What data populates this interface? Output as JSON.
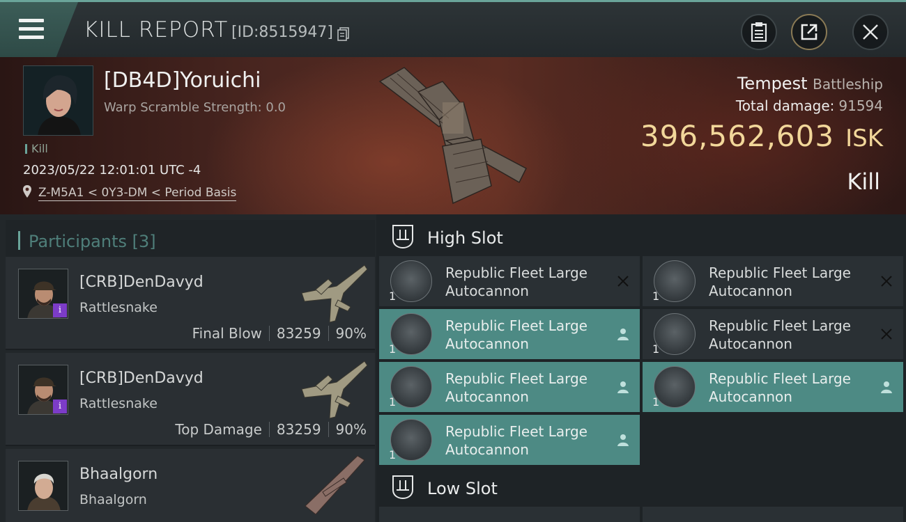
{
  "header": {
    "title": "KILL REPORT",
    "report_id": "[ID:8515947]"
  },
  "victim": {
    "name": "[DB4D]Yoruichi",
    "warp_scramble": "Warp Scramble Strength: 0.0",
    "kill_tag": "Kill",
    "datetime": "2023/05/22 12:01:01 UTC -4",
    "location": "Z-M5A1 < 0Y3-DM < Period Basis",
    "ship_name": "Tempest",
    "ship_class": "Battleship",
    "total_damage_label": "Total damage:",
    "total_damage": "91594",
    "isk_value": "396,562,603",
    "isk_unit": "ISK",
    "result": "Kill"
  },
  "participants": {
    "title": "Participants [3]",
    "items": [
      {
        "name": "[CRB]DenDavyd",
        "ship": "Rattlesnake",
        "role": "Final Blow",
        "damage": "83259",
        "percent": "90%",
        "badge": "i"
      },
      {
        "name": "[CRB]DenDavyd",
        "ship": "Rattlesnake",
        "role": "Top Damage",
        "damage": "83259",
        "percent": "90%",
        "badge": "i"
      },
      {
        "name": "Bhaalgorn",
        "ship": "Bhaalgorn",
        "role": "",
        "damage": "",
        "percent": ""
      }
    ]
  },
  "fitting": {
    "high_slot_label": "High Slot",
    "low_slot_label": "Low Slot",
    "modules": [
      {
        "line1": "Republic Fleet Large",
        "line2": "Autocannon",
        "qty": "1",
        "status": "destroyed"
      },
      {
        "line1": "Republic Fleet Large",
        "line2": "Autocannon",
        "qty": "1",
        "status": "destroyed"
      },
      {
        "line1": "Republic Fleet Large",
        "line2": "Autocannon",
        "qty": "1",
        "status": "dropped"
      },
      {
        "line1": "Republic Fleet Large",
        "line2": "Autocannon",
        "qty": "1",
        "status": "destroyed"
      },
      {
        "line1": "Republic Fleet Large",
        "line2": "Autocannon",
        "qty": "1",
        "status": "dropped"
      },
      {
        "line1": "Republic Fleet Large",
        "line2": "Autocannon",
        "qty": "1",
        "status": "dropped"
      },
      {
        "line1": "Republic Fleet Large",
        "line2": "Autocannon",
        "qty": "1",
        "status": "dropped"
      }
    ]
  },
  "colors": {
    "accent_teal": "#6aa49a",
    "isk_gold": "#f2d79a",
    "active_module": "#4d8a84",
    "badge_purple": "#7c3cc8"
  },
  "icons": {
    "menu": "hamburger-icon",
    "copy": "copy-icon",
    "clipboard": "clipboard-icon",
    "share": "share-icon",
    "close": "close-icon",
    "location": "location-pin-icon",
    "slot": "slot-icon",
    "destroyed": "x-icon",
    "dropped": "person-icon"
  }
}
